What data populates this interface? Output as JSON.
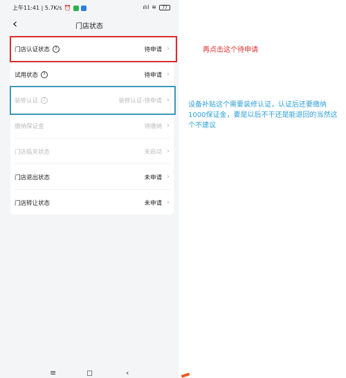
{
  "status_bar": {
    "time_speed": "上午11:41 | 5.7K/s",
    "signal": "ılıl",
    "battery": "77"
  },
  "header": {
    "back_icon": "‹",
    "title": "门店状态"
  },
  "rows": [
    {
      "label": "门店认证状态",
      "value": "待申请",
      "help": true,
      "disabled": false
    },
    {
      "label": "试用状态",
      "value": "待申请",
      "help": true,
      "disabled": false
    },
    {
      "label": "装修认证",
      "value": "装修认证-待申请",
      "help": true,
      "disabled": true
    },
    {
      "label": "缴纳保证金",
      "value": "待缴纳",
      "help": false,
      "disabled": true
    },
    {
      "label": "门店临关状态",
      "value": "未启动",
      "help": false,
      "disabled": true
    },
    {
      "label": "门店退出状态",
      "value": "未申请",
      "help": false,
      "disabled": false
    },
    {
      "label": "门店转让状态",
      "value": "未申请",
      "help": false,
      "disabled": false
    }
  ],
  "annotations": {
    "red": "再点击这个待申请",
    "blue": "设备补贴这个需要装修认证，认证后还要缴纳1000保证金，要是以后不干还是能退回的当然这个不建议"
  },
  "bottom_nav": {
    "menu": "≡",
    "home": "◻",
    "back": "‹"
  },
  "colors": {
    "annotation_red": "#d92b2b",
    "annotation_blue": "#3a98b8"
  }
}
